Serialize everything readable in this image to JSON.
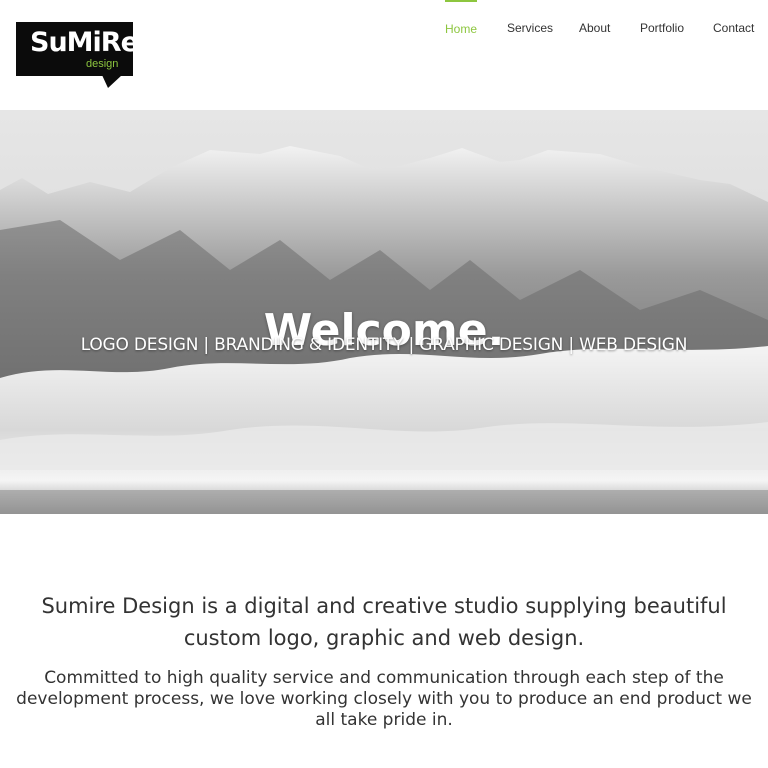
{
  "logo": {
    "wordmark": "SuMiRe",
    "tagline": "design",
    "colors": {
      "background": "#0b0b0b",
      "tagline": "#8dc63f"
    }
  },
  "nav": {
    "items": [
      {
        "label": "Home",
        "active": true
      },
      {
        "label": "Services",
        "active": false
      },
      {
        "label": "About",
        "active": false
      },
      {
        "label": "Portfolio",
        "active": false
      },
      {
        "label": "Contact",
        "active": false
      }
    ],
    "accent_color": "#8dc63f"
  },
  "hero": {
    "title": "Welcome.",
    "subtitle": "LOGO DESIGN | BRANDING & IDENTITY | GRAPHIC DESIGN | WEB DESIGN"
  },
  "intro": {
    "headline": "Sumire Design is a digital and creative studio supplying beautiful custom logo, graphic and web design.",
    "body": "Committed to high quality service and communication through each step of the development process, we love working closely with you to produce an end product we all take pride in."
  }
}
